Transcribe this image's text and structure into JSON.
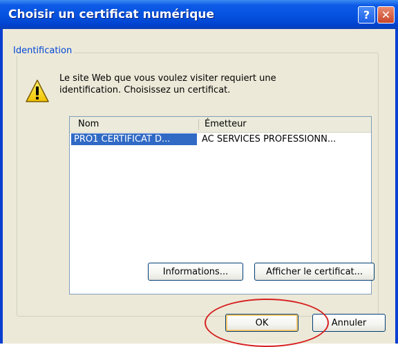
{
  "dialog": {
    "title": "Choisir un certificat numérique",
    "help_glyph": "?",
    "close_glyph": "✕"
  },
  "group": {
    "label": "Identification",
    "icon": "warning-icon",
    "message": "Le site Web que vous voulez visiter requiert une identification. Choisissez un certificat."
  },
  "certificates": {
    "columns": [
      "Nom",
      "Émetteur"
    ],
    "rows": [
      {
        "name": "PRO1 CERTIFICAT D...",
        "issuer": "AC SERVICES PROFESSIONN...",
        "selected": true
      }
    ]
  },
  "buttons": {
    "info": "Informations...",
    "view": "Afficher le certificat...",
    "ok": "OK",
    "cancel": "Annuler"
  },
  "colors": {
    "titlebar": "#0452df",
    "selection": "#316ac5",
    "group_label": "#0046d5",
    "annotation": "#d62020"
  }
}
